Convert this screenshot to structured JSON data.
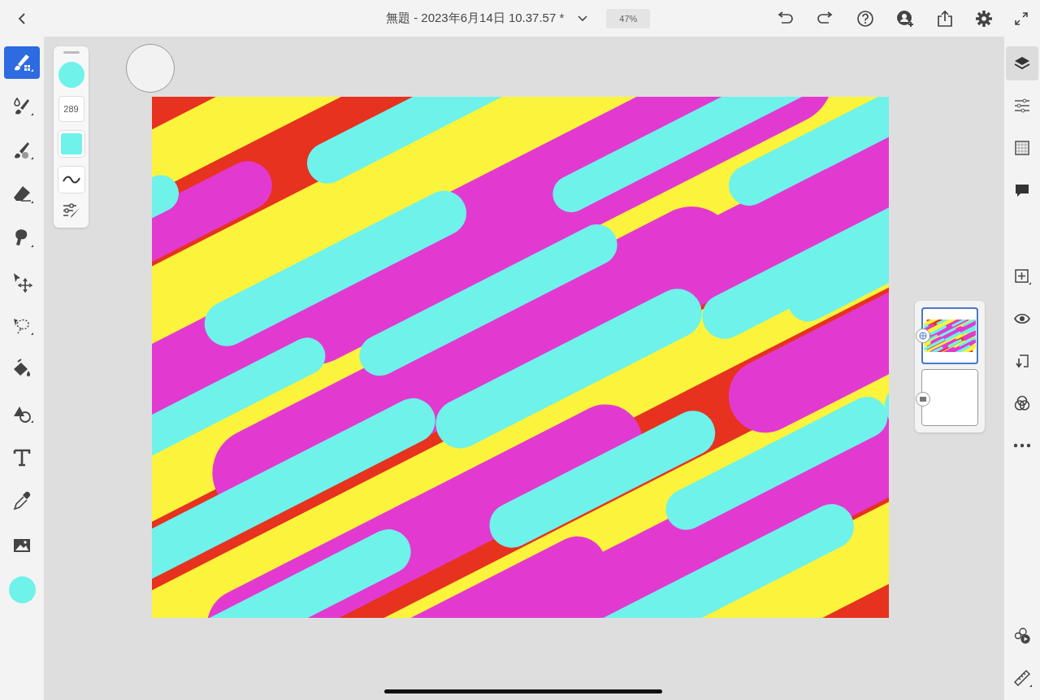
{
  "title_bar": {
    "document_title": "無題 - 2023年6月14日 10.37.57 *",
    "zoom": "47%"
  },
  "tools": [
    {
      "selected": true,
      "submenu": true
    },
    {
      "selected": false,
      "submenu": true
    },
    {
      "selected": false,
      "submenu": true
    },
    {
      "selected": false,
      "submenu": true
    },
    {
      "selected": false,
      "submenu": true
    },
    {
      "selected": false,
      "submenu": false
    },
    {
      "selected": false,
      "submenu": true
    },
    {
      "selected": false,
      "submenu": false
    },
    {
      "selected": false,
      "submenu": true
    },
    {
      "selected": false,
      "submenu": false
    },
    {
      "selected": false,
      "submenu": false
    },
    {
      "selected": false,
      "submenu": false
    }
  ],
  "brush_panel": {
    "size": "289"
  },
  "right_tools": [
    {
      "selected": true
    },
    {
      "selected": false
    },
    {
      "selected": false
    },
    {
      "selected": false
    }
  ],
  "layers": [
    {
      "selected": true,
      "kind": "pixel"
    },
    {
      "selected": false,
      "kind": "image"
    }
  ]
}
